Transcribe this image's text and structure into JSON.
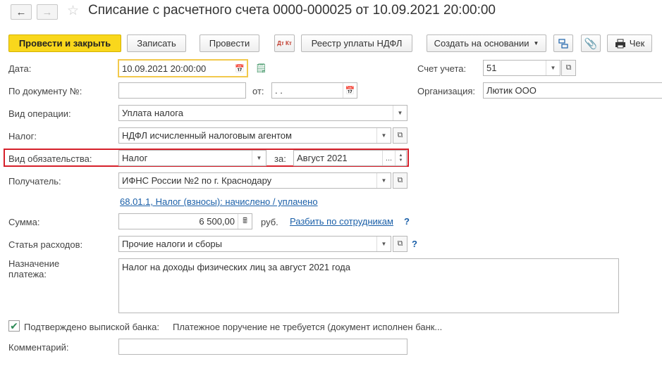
{
  "window": {
    "title": "Списание с расчетного счета 0000-000025 от 10.09.2021 20:00:00"
  },
  "toolbar": {
    "post_close": "Провести и закрыть",
    "save": "Записать",
    "post": "Провести",
    "dt_kt_icon": "Дт Кт",
    "ndfl_registry": "Реестр уплаты НДФЛ",
    "create_based_on": "Создать на основании",
    "receipt": "Чек"
  },
  "form": {
    "date_label": "Дата:",
    "date_value": "10.09.2021 20:00:00",
    "account_label": "Счет учета:",
    "account_value": "51",
    "doc_num_label": "По документу №:",
    "doc_num_value": "",
    "doc_from_label": "от:",
    "doc_from_value": " .  .",
    "org_label": "Организация:",
    "org_value": "Лютик ООО",
    "operation_label": "Вид операции:",
    "operation_value": "Уплата налога",
    "tax_label": "Налог:",
    "tax_value": "НДФЛ исчисленный налоговым агентом",
    "obligation_label": "Вид обязательства:",
    "obligation_value": "Налог",
    "period_label": "за:",
    "period_value": "Август 2021",
    "period_dots": "...",
    "recipient_label": "Получатель:",
    "recipient_value": "ИФНС России №2 по г. Краснодару",
    "account_link": "68.01.1, Налог (взносы): начислено / уплачено",
    "sum_label": "Сумма:",
    "sum_value": "6 500,00",
    "currency": "руб.",
    "split_link": "Разбить по сотрудникам",
    "help_mark": "?",
    "expense_label": "Статья расходов:",
    "expense_value": "Прочие налоги и сборы",
    "purpose_label_1": "Назначение",
    "purpose_label_2": "платежа:",
    "purpose_value": "Налог на доходы физических лиц за август 2021 года",
    "bank_confirmed_label": "Подтверждено выпиской банка:",
    "payment_order_text": "Платежное поручение не требуется (документ исполнен банк...",
    "comment_label": "Комментарий:",
    "comment_value": ""
  },
  "colors": {
    "primary_button": "#f9d71c",
    "link": "#1a5fa8",
    "highlight_border": "#d6202a",
    "focus_border": "#f2c94c"
  }
}
